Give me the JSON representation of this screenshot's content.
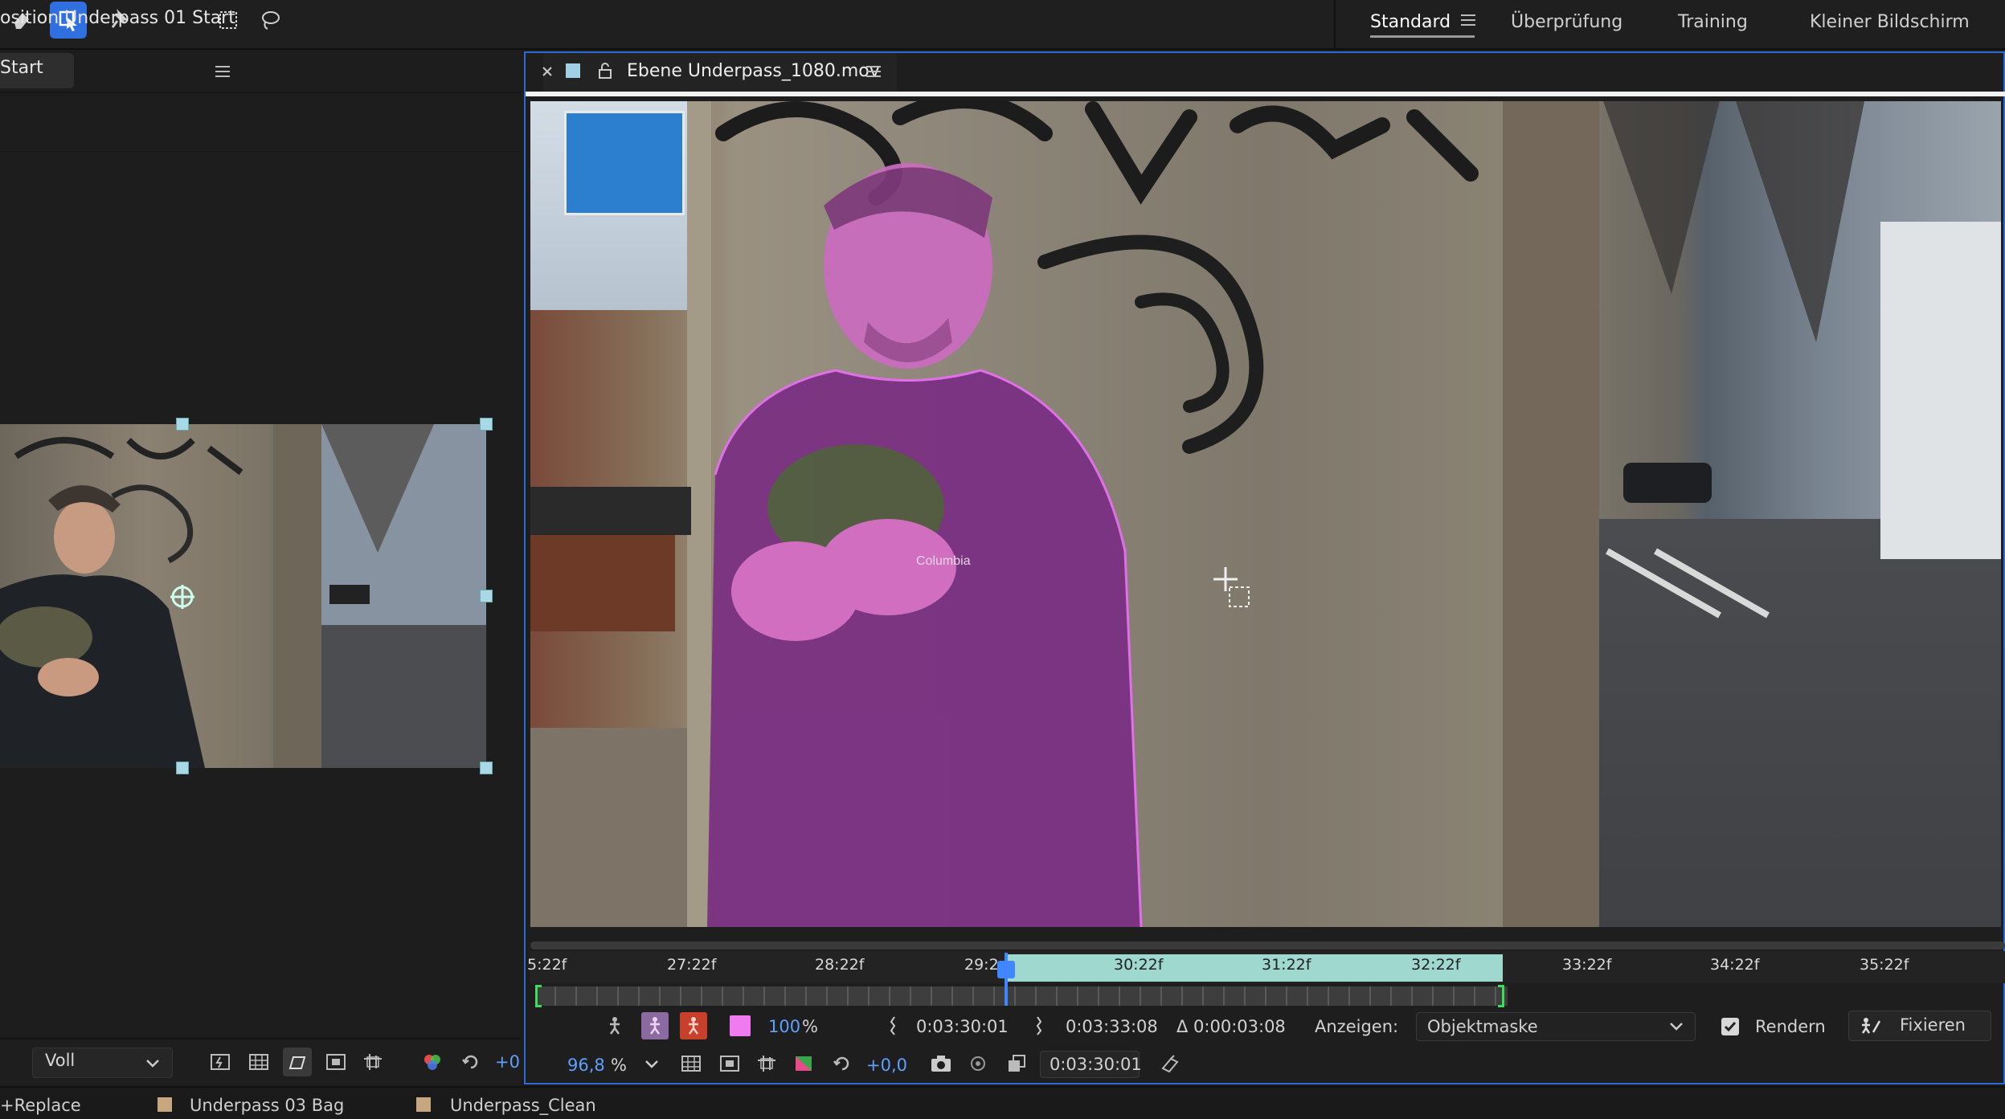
{
  "workspaces": {
    "items": [
      "Standard",
      "Überprüfung",
      "Training",
      "Kleiner Bildschirm"
    ],
    "active": "Standard"
  },
  "left_panel": {
    "tab_label": "osition Underpass 01 Start",
    "sub_label": "Start",
    "resolution": "Voll",
    "offset_value": "+0"
  },
  "viewer": {
    "tab_label": "Ebene Underpass_1080.mov",
    "frame_text": "Columbia"
  },
  "timeline": {
    "ticks": [
      "5:22f",
      "27:22f",
      "28:22f",
      "29:2",
      "30:22f",
      "31:22f",
      "32:22f",
      "33:22f",
      "34:22f",
      "35:22f"
    ]
  },
  "controls": {
    "zoom_percent": "100",
    "percent_sign": "%",
    "in_time": "0:03:30:01",
    "out_time": "0:03:33:08",
    "duration": "Δ 0:00:03:08",
    "show_label": "Anzeigen:",
    "show_value": "Objektmaske",
    "render_label": "Rendern",
    "render_checked": true,
    "fix_label": "Fixieren",
    "mag_value": "96,8",
    "mag_sign": "%",
    "exposure": "+0,0",
    "current_time": "0:03:30:01"
  },
  "colors": {
    "accent": "#2b6cd4",
    "mask_overlay": "#c030c8",
    "workarea": "#9fd8cf",
    "keyframe_bracket": "#3ddc5a"
  },
  "bottom_tabs": [
    {
      "label": "+Replace"
    },
    {
      "label": "Underpass 03 Bag"
    },
    {
      "label": "Underpass_Clean"
    }
  ]
}
